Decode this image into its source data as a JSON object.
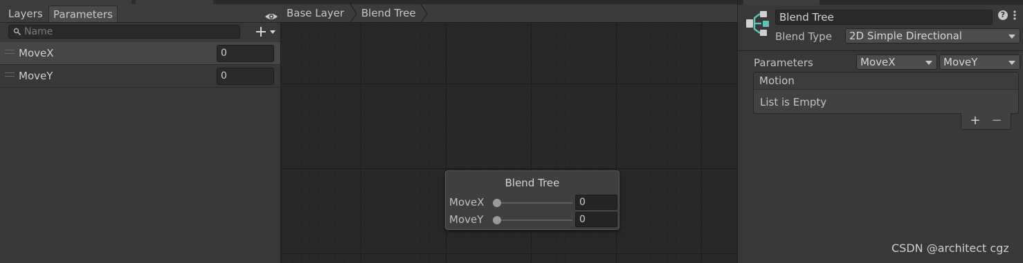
{
  "parameters_panel": {
    "tabs": [
      {
        "label": "Layers",
        "active": false
      },
      {
        "label": "Parameters",
        "active": true
      }
    ],
    "search": {
      "placeholder": "Name",
      "value": ""
    },
    "add_button_icon": "plus-dropdown-icon",
    "visibility_icon": "eye-icon",
    "params": [
      {
        "name": "MoveX",
        "value": "0",
        "selected": true
      },
      {
        "name": "MoveY",
        "value": "0",
        "selected": false
      }
    ]
  },
  "graph": {
    "breadcrumb": [
      "Base Layer",
      "Blend Tree"
    ],
    "node": {
      "title": "Blend Tree",
      "rows": [
        {
          "label": "MoveX",
          "value": "0"
        },
        {
          "label": "MoveY",
          "value": "0"
        }
      ]
    }
  },
  "inspector": {
    "icon": "blend-tree-icon",
    "name": "Blend Tree",
    "help_icon": "?",
    "blend_type_label": "Blend Type",
    "blend_type": "2D Simple Directional",
    "parameters_label": "Parameters",
    "param_x": "MoveX",
    "param_y": "MoveY",
    "motion_header": "Motion",
    "motion_empty": "List is Empty",
    "add_symbol": "+",
    "remove_symbol": "−",
    "accent_color": "#5ec4b6"
  },
  "watermark": "CSDN @architect cgz"
}
